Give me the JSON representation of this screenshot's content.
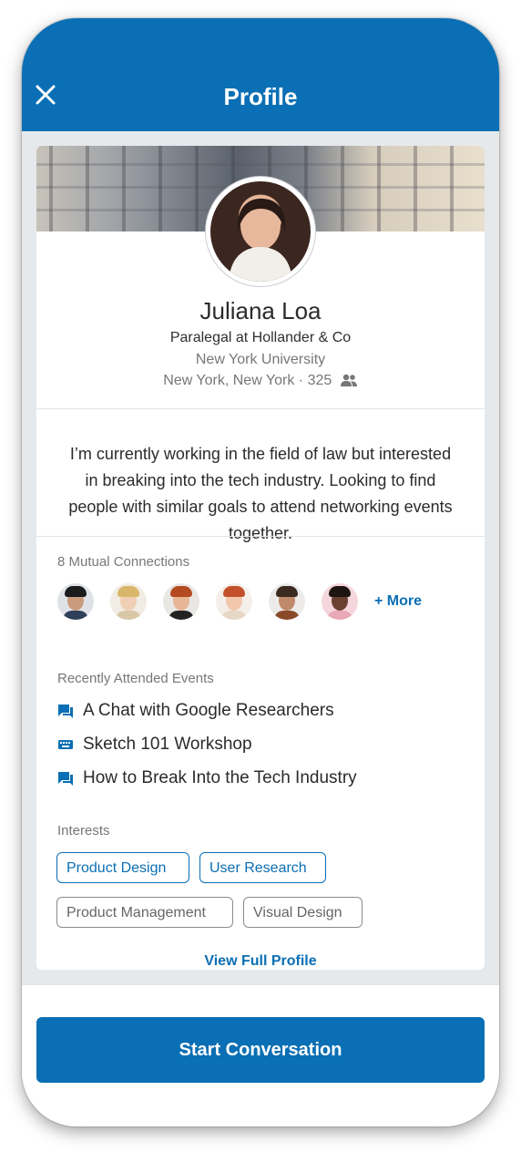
{
  "header": {
    "title": "Profile",
    "close_icon": "close-icon"
  },
  "profile": {
    "name": "Juliana Loa",
    "headline": "Paralegal at Hollander & Co",
    "school": "New York University",
    "location": "New York, New York · 325",
    "connections_icon": "people-icon",
    "bio": "I’m currently working in the field of law but interested in breaking into the tech industry. Looking to find people with similar goals to attend networking events together."
  },
  "mutual": {
    "label": "8 Mutual Connections",
    "more_label": "+ More"
  },
  "events": {
    "label": "Recently Attended Events",
    "items": [
      {
        "title": "A Chat with Google Researchers",
        "icon": "chat-icon"
      },
      {
        "title": "Sketch 101 Workshop",
        "icon": "keyboard-icon"
      },
      {
        "title": "How to Break Into the Tech Industry",
        "icon": "chat-icon"
      }
    ]
  },
  "interests": {
    "label": "Interests",
    "tags": [
      {
        "label": "Product Design",
        "selected": true
      },
      {
        "label": "User Research",
        "selected": true
      },
      {
        "label": "Product Management",
        "selected": false
      },
      {
        "label": "Visual Design",
        "selected": false
      }
    ]
  },
  "links": {
    "view_full_profile": "View Full Profile"
  },
  "footer": {
    "cta_label": "Start Conversation"
  },
  "colors": {
    "brand": "#0a6fb4",
    "background": "#e6e9ec"
  }
}
